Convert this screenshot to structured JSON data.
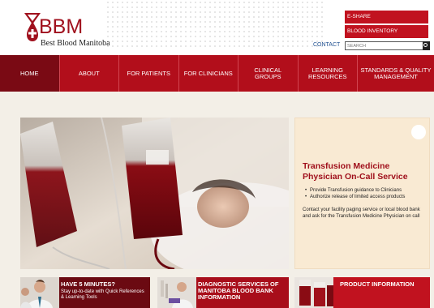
{
  "header": {
    "logo_letters": "BBM",
    "logo_subtitle": "Best Blood Manitoba",
    "quick_links": [
      "E-SHARE",
      "BLOOD INVENTORY"
    ],
    "contact_label": "CONTACT",
    "search_placeholder": "SEARCH"
  },
  "nav": {
    "items": [
      {
        "label": "HOME"
      },
      {
        "label": "ABOUT"
      },
      {
        "label": "FOR PATIENTS"
      },
      {
        "label": "FOR CLINICIANS"
      },
      {
        "label": "CLINICAL GROUPS"
      },
      {
        "label": "LEARNING RESOURCES"
      },
      {
        "label": "STANDARDS & QUALITY MANAGEMENT"
      }
    ]
  },
  "feature": {
    "title": "Transfusion Medicine Physician On-Call Service",
    "bullets": [
      "Provide Transfusion guidance to Clinicians",
      "Authorize release of limited access products"
    ],
    "body": "Contact your facility paging service or local blood bank and ask for the Transfusion Medicine Physician on call"
  },
  "tiles": [
    {
      "title": "HAVE 5 MINUTES?",
      "subtitle": "Stay up-to-date with Quick References & Learning Tools"
    },
    {
      "title": "DIAGNOSTIC SERVICES OF MANITOBA BLOOD BANK INFORMATION"
    },
    {
      "title": "PRODUCT INFORMATION"
    }
  ],
  "colors": {
    "brand_red": "#b20e1b",
    "nav_active": "#7a0a14",
    "panel_bg": "#f9ead3",
    "link_blue": "#1f4f8f"
  }
}
